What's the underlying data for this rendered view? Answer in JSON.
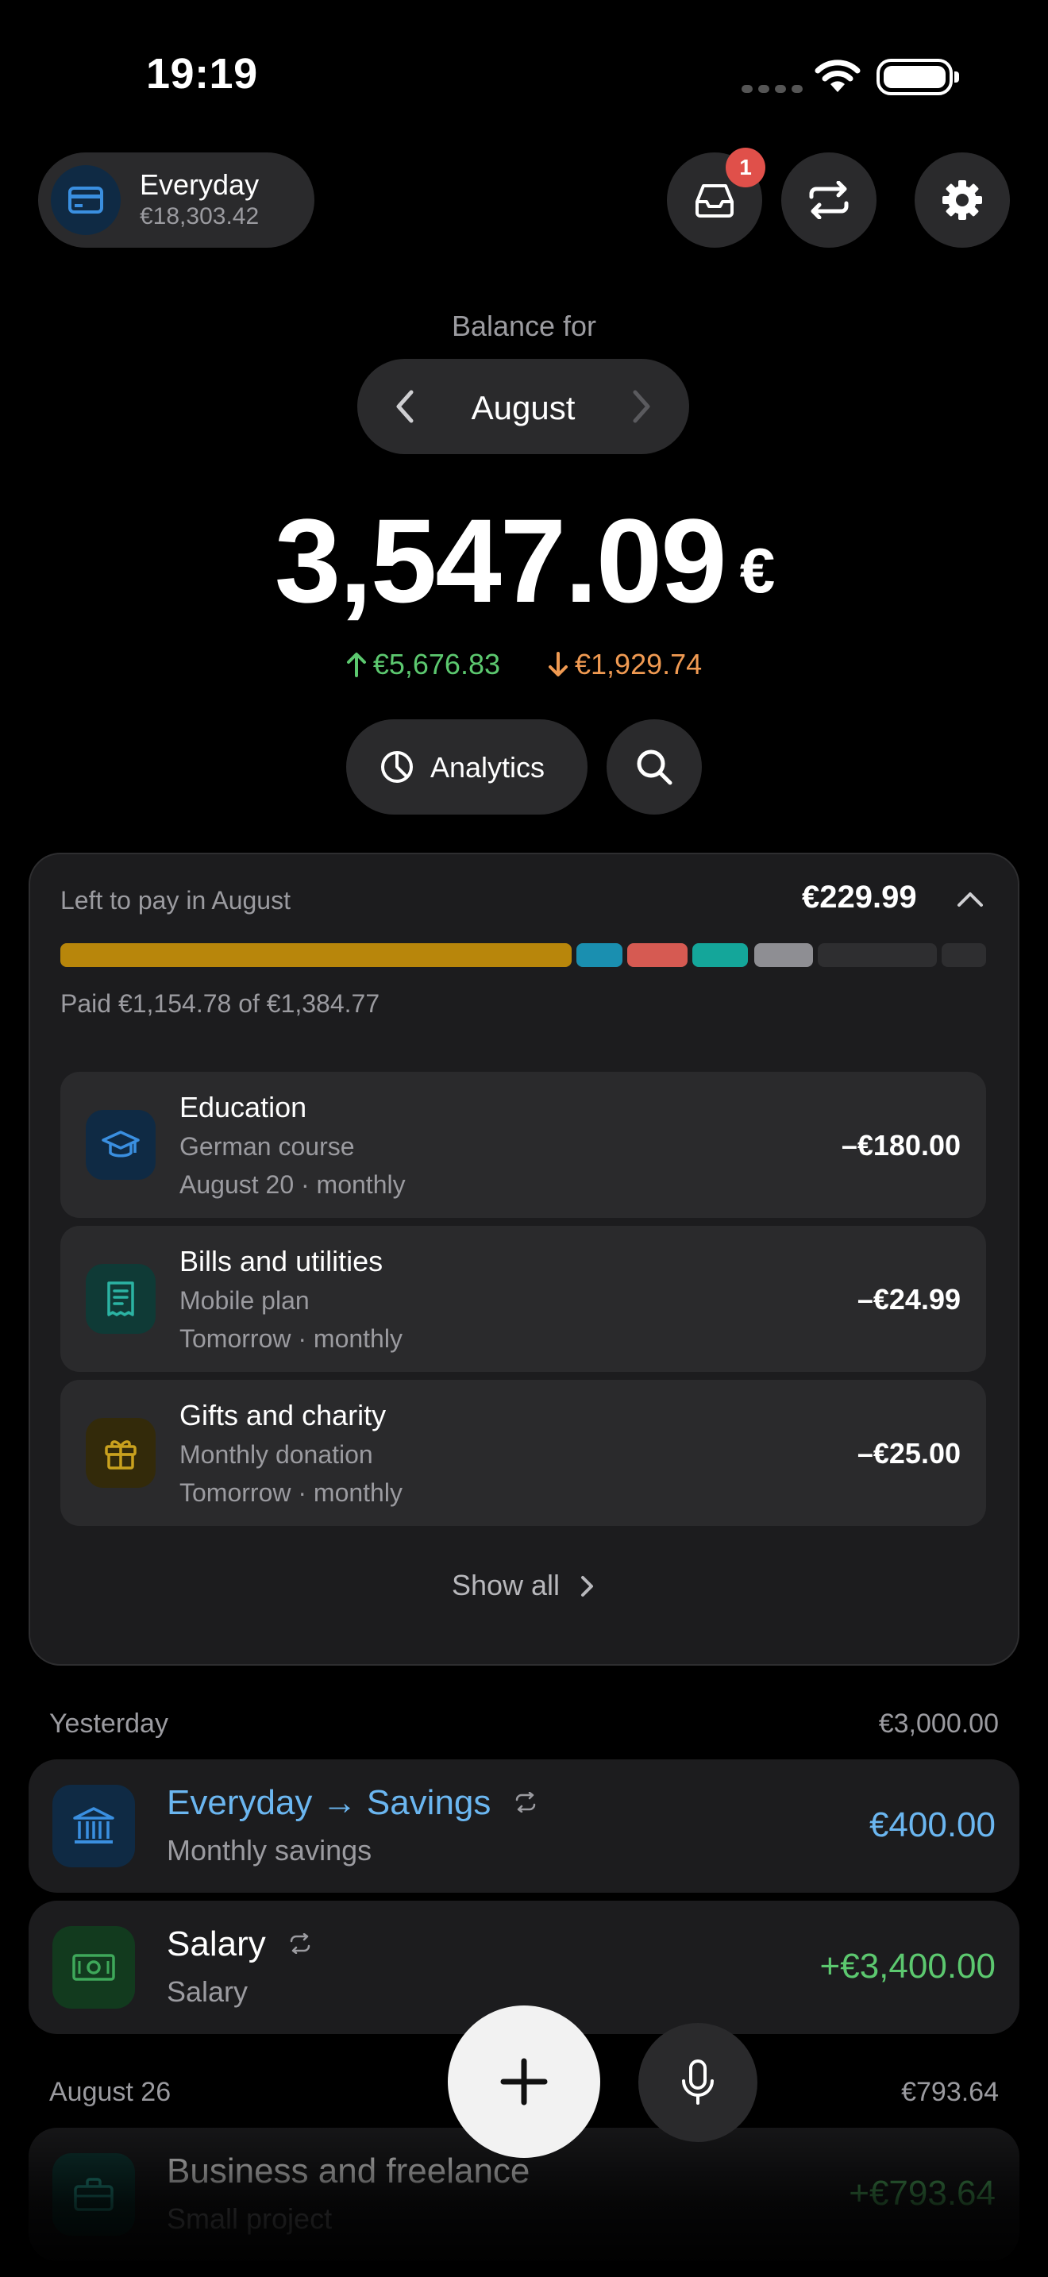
{
  "status_bar": {
    "time": "19:19"
  },
  "account": {
    "name": "Everyday",
    "balance": "€18,303.42",
    "icon": "card-icon"
  },
  "header_actions": {
    "inbox_badge": "1"
  },
  "balance": {
    "label": "Balance for",
    "month": "August",
    "amount": "3,547.09",
    "currency": "€",
    "income": "€5,676.83",
    "expense": "€1,929.74"
  },
  "analytics": {
    "label": "Analytics"
  },
  "left_to_pay": {
    "title": "Left to pay in August",
    "amount": "€229.99",
    "paid_text": "Paid €1,154.78 of €1,384.77",
    "segments": [
      {
        "color": "#b8860b"
      },
      {
        "color": "#1a8fb0"
      },
      {
        "color": "#d65a52"
      },
      {
        "color": "#14a69a"
      },
      {
        "color": "#8e8e93"
      },
      {
        "color": "#2e2e30"
      },
      {
        "color": "#2e2e30"
      }
    ],
    "items": [
      {
        "title": "Education",
        "subtitle": "German course",
        "schedule": "August 20 · monthly",
        "amount": "–€180.00",
        "icon": "graduation-cap-icon",
        "color": "#3a8fe0"
      },
      {
        "title": "Bills and utilities",
        "subtitle": "Mobile plan",
        "schedule": "Tomorrow · monthly",
        "amount": "–€24.99",
        "icon": "receipt-icon",
        "color": "#2bb3a3"
      },
      {
        "title": "Gifts and charity",
        "subtitle": "Monthly donation",
        "schedule": "Tomorrow · monthly",
        "amount": "–€25.00",
        "icon": "gift-icon",
        "color": "#c9a11e"
      }
    ],
    "show_all": "Show all"
  },
  "transactions": {
    "sections": [
      {
        "date": "Yesterday",
        "total": "€3,000.00",
        "items": [
          {
            "title": "Everyday → Savings",
            "subtitle": "Monthly savings",
            "amount": "€400.00",
            "icon": "bank-icon",
            "amount_color": "#6bb6f0"
          },
          {
            "title": "Salary",
            "subtitle": "Salary",
            "amount": "+€3,400.00",
            "icon": "banknote-icon",
            "amount_color": "#5cc86f"
          }
        ]
      },
      {
        "date": "August 26",
        "total": "€793.64",
        "items": [
          {
            "title": "Business and freelance",
            "subtitle": "Small project",
            "amount": "+€793.64",
            "icon": "briefcase-icon",
            "amount_color": "#5cc86f"
          }
        ]
      }
    ]
  }
}
